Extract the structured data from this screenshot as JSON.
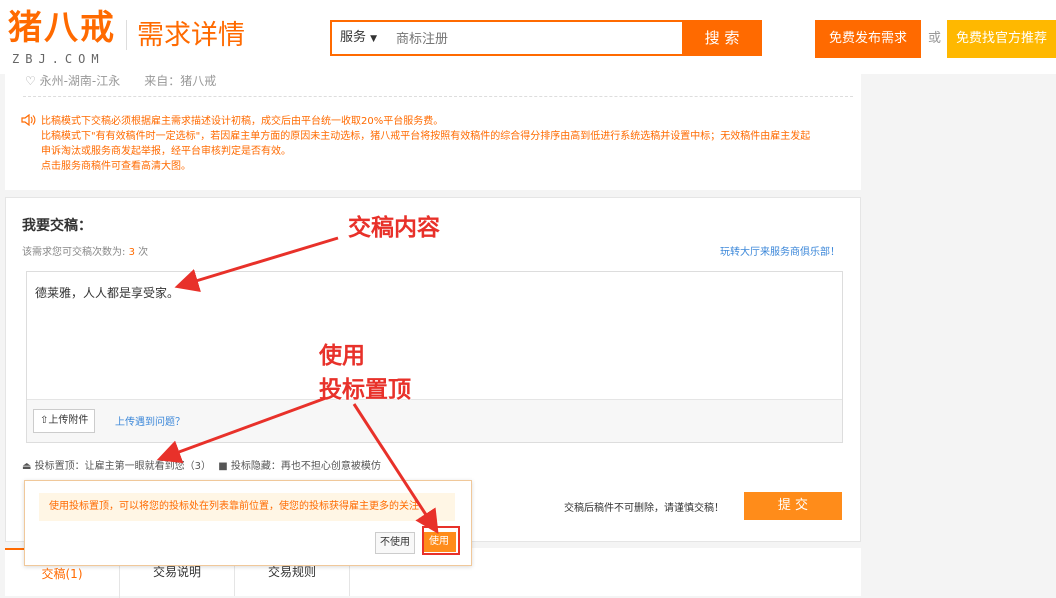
{
  "header": {
    "logo_cn": "猪八戒",
    "logo_en": "ZBJ.COM",
    "page_title": "需求详情",
    "search": {
      "type": "服务",
      "placeholder": "商标注册",
      "button": "搜 索"
    },
    "publish_button": "免费发布需求",
    "or_text": "或",
    "find_button": "免费找官方推荐"
  },
  "top_panel": {
    "meta": "永州-湖南-江永　　来自：猪八戒",
    "notice_lines": [
      "比稿模式下交稿必须根据雇主需求描述设计初稿，成交后由平台统一收取20%平台服务费。",
      "比稿模式下\"有有效稿件时一定选标\"，若因雇主单方面的原因未主动选标，猪八戒平台将按照有效稿件的综合得分排序由高到低进行系统选稿并设置中标；无效稿件由雇主发起",
      "申诉淘汰或服务商发起举报，经平台审核判定是否有效。",
      "点击服务商稿件可查看高清大图。"
    ]
  },
  "submit": {
    "title": "我要交稿：",
    "count_prefix": "该需求您可交稿次数为: ",
    "count_value": "3",
    "count_suffix": " 次",
    "club_link": "玩转大厅来服务商俱乐部！",
    "editor_text": "德莱雅，人人都是享受家。",
    "upload_button": "上传附件",
    "upload_help": "上传遇到问题？",
    "top_option": "投标置顶：让雇主第一眼就看到您（3）",
    "hide_option": "投标隐藏：再也不担心创意被模仿",
    "warning": "交稿后稿件不可删除，请谨慎交稿！",
    "submit_button": "提 交"
  },
  "popup": {
    "message": "使用投标置顶，可以将您的投标处在列表靠前位置，使您的投标获得雇主更多的关注",
    "no_button": "不使用",
    "yes_button": "使用"
  },
  "tabs": [
    "交稿(1)",
    "交易说明",
    "交易规则"
  ],
  "annotations": {
    "content": "交稿内容",
    "use": "使用",
    "top": "投标置顶"
  },
  "colors": {
    "accent": "#ff6a00",
    "yellow": "#ffb800",
    "link": "#3b87d9",
    "annotation": "#e8312a"
  }
}
